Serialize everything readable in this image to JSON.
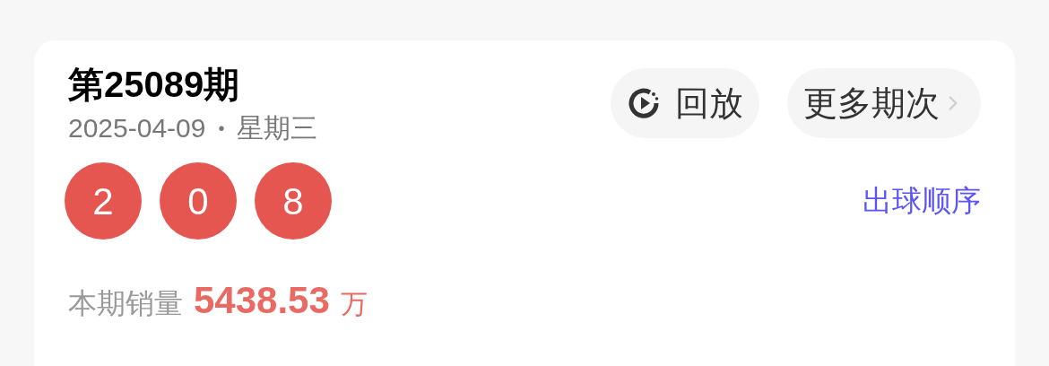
{
  "draw": {
    "title": "第25089期",
    "date": "2025-04-09",
    "separator": "•",
    "weekday": "星期三",
    "buttons": [
      {
        "kind": "replay",
        "label": "回放"
      },
      {
        "kind": "more",
        "label": "更多期次"
      }
    ],
    "balls": [
      "2",
      "0",
      "8"
    ],
    "order_link": "出球顺序",
    "sales": {
      "label": "本期销量",
      "value": "5438.53",
      "unit": "万"
    }
  }
}
